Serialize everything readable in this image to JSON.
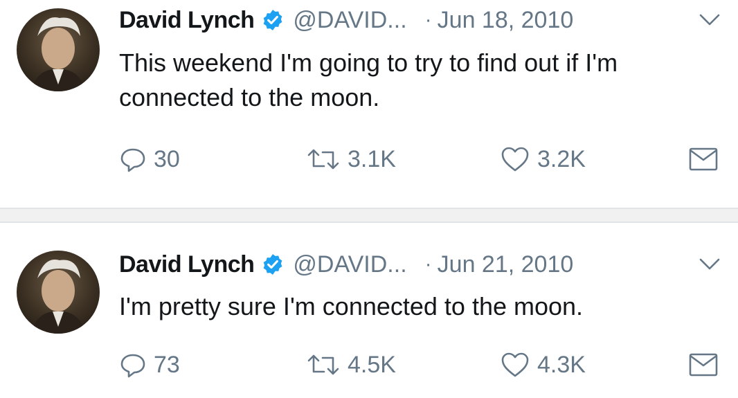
{
  "tweets": [
    {
      "author": "David Lynch",
      "handle": "@DAVID...",
      "separator": "·",
      "date": "Jun 18, 2010",
      "text": "This weekend I'm going to try to find out if I'm connected to the moon.",
      "replies": "30",
      "retweets": "3.1K",
      "likes": "3.2K"
    },
    {
      "author": "David Lynch",
      "handle": "@DAVID...",
      "separator": "·",
      "date": "Jun 21, 2010",
      "text": "I'm pretty sure I'm connected to the moon.",
      "replies": "73",
      "retweets": "4.5K",
      "likes": "4.3K"
    }
  ],
  "colors": {
    "text": "#14171a",
    "muted": "#657786",
    "verified": "#1da1f2",
    "divider": "#e1e4e6"
  },
  "icons": [
    "verified-badge-icon",
    "chevron-down-icon",
    "reply-icon",
    "retweet-icon",
    "like-icon",
    "direct-message-icon"
  ]
}
